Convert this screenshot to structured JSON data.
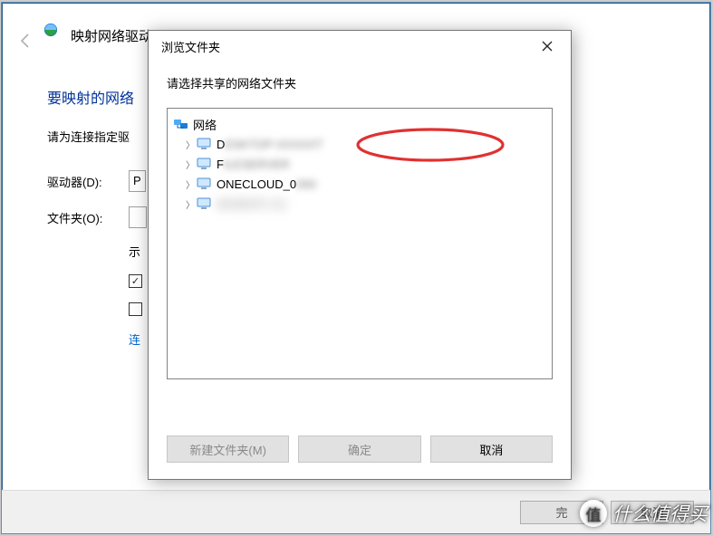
{
  "back": {
    "title": "映射网络驱动",
    "heading": "要映射的网络",
    "sub": "请为连接指定驱",
    "drive_label": "驱动器(D):",
    "drive_value": "P",
    "folder_label": "文件夹(O):",
    "example_prefix": "示",
    "chk1_checked": true,
    "chk1_label": "",
    "chk2_checked": false,
    "chk2_label": "",
    "link": "连",
    "footer_primary": "完",
    "footer_secondary": "取消"
  },
  "dlg": {
    "title": "浏览文件夹",
    "sub": "请选择共享的网络文件夹",
    "root": "网络",
    "items": [
      {
        "label_visible": "D",
        "label_rest": "ESKTOP-XXXXXT"
      },
      {
        "label_visible": "F",
        "label_rest": "ILESERVER"
      },
      {
        "label_visible": "ONECLOUD_0",
        "label_rest": "000"
      },
      {
        "label_visible": "",
        "label_rest": "WORKPC-01"
      }
    ],
    "btn_new": "新建文件夹(M)",
    "btn_ok": "确定",
    "btn_cancel": "取消"
  },
  "watermark": "什么值得买"
}
